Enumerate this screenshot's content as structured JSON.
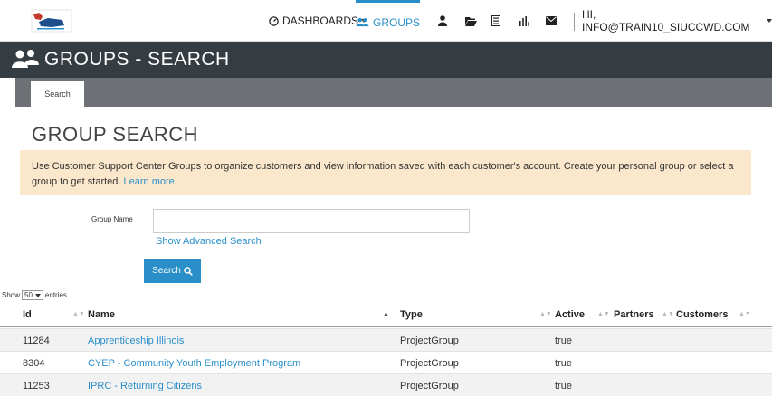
{
  "nav": {
    "dashboards": "DASHBOARDS",
    "groups": "GROUPS",
    "user": "HI, INFO@TRAIN10_SIUCCWD.COM",
    "accent": "#2a8fc9"
  },
  "header": {
    "title": "GROUPS - SEARCH"
  },
  "tabs": [
    {
      "label": "Search"
    }
  ],
  "page": {
    "heading": "GROUP SEARCH",
    "info_text": "Use Customer Support Center Groups to organize customers and view information saved with each customer's account. Create your personal group or select a group to get started.",
    "learn_more": "Learn more"
  },
  "form": {
    "group_name_label": "Group Name",
    "group_name_value": "",
    "advanced_link": "Show Advanced Search",
    "search_button": "Search"
  },
  "entries": {
    "show": "Show",
    "value": "50",
    "suffix": "entries"
  },
  "table": {
    "columns": [
      "Id",
      "Name",
      "Type",
      "Active",
      "Partners",
      "Customers"
    ],
    "rows": [
      {
        "id": "11284",
        "name": "Apprenticeship Illinois",
        "type": "ProjectGroup",
        "active": "true",
        "partners": "",
        "customers": ""
      },
      {
        "id": "8304",
        "name": "CYEP - Community Youth Employment Program",
        "type": "ProjectGroup",
        "active": "true",
        "partners": "",
        "customers": ""
      },
      {
        "id": "11253",
        "name": "IPRC - Returning Citizens",
        "type": "ProjectGroup",
        "active": "true",
        "partners": "",
        "customers": ""
      }
    ]
  }
}
